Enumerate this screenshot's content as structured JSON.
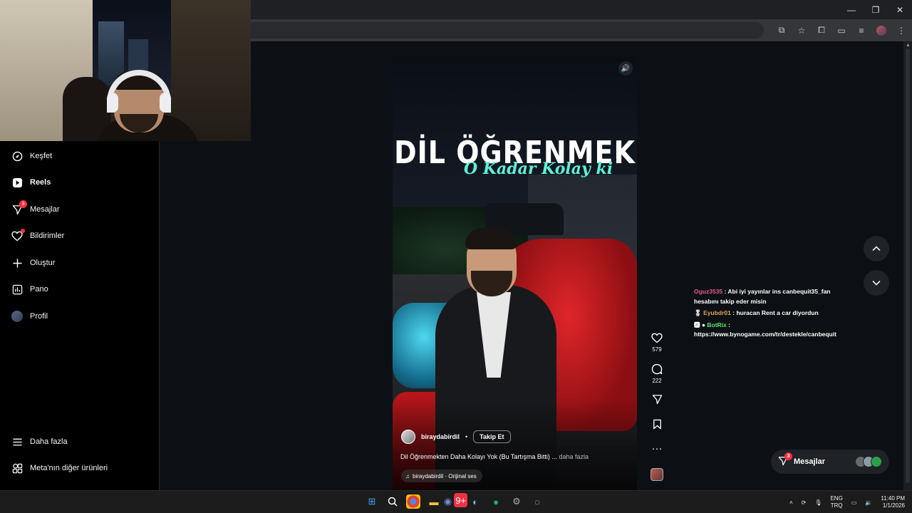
{
  "browser": {
    "window_controls": [
      "—",
      "❐",
      "✕"
    ]
  },
  "sidebar": {
    "items": [
      {
        "label": "Keşfet",
        "icon": "compass-icon"
      },
      {
        "label": "Reels",
        "icon": "reels-icon",
        "active": true
      },
      {
        "label": "Mesajlar",
        "icon": "messenger-icon",
        "badge": "3"
      },
      {
        "label": "Bildirimler",
        "icon": "heart-icon"
      },
      {
        "label": "Oluştur",
        "icon": "plus-icon"
      },
      {
        "label": "Pano",
        "icon": "dashboard-icon"
      },
      {
        "label": "Profil",
        "icon": "profile-avatar"
      }
    ],
    "footer": [
      {
        "label": "Daha fazla",
        "icon": "menu-icon"
      },
      {
        "label": "Meta'nın diğer ürünleri",
        "icon": "meta-products-icon"
      }
    ]
  },
  "reel": {
    "title_line1": "DİL ÖĞRENMEK",
    "title_line2": "O Kadar Kolay ki",
    "author": "biraydabirdil",
    "follow_label": "Takip Et",
    "caption": "Dil Öğrenmekten Daha Kolayı Yok (Bu Tartışma Bitti) ...",
    "caption_more": "daha fazla",
    "audio": "biraydabirdil · Orijinal ses"
  },
  "actions": {
    "likes": "579",
    "comments": "222"
  },
  "chat": [
    {
      "user": "Oguz3535",
      "prefix": "",
      "text": ": Abi iyi yayınlar ins canbequit35_fan hesabını takip eder misin"
    },
    {
      "user": "Eyubdr01",
      "prefix": "🎖 ",
      "text": ": huracan Rent a car diyordun"
    },
    {
      "user": "BotRix",
      "prefix": "🅺 ● ",
      "text": ": https://www.bynogame.com/tr/destekle/canbequit"
    }
  ],
  "messages_pill": {
    "label": "Mesajlar",
    "badge": "3"
  },
  "taskbar": {
    "lang_top": "ENG",
    "lang_bottom": "TRQ",
    "time": "11:40 PM",
    "date": "1/1/2026",
    "discord_badge": "9+"
  },
  "colors": {
    "accent_teal": "#5ff0d6",
    "badge_red": "#ff3040",
    "chat_user1": "#e35a8b",
    "chat_user2": "#e3a45a",
    "chat_user3": "#5ae36b"
  }
}
